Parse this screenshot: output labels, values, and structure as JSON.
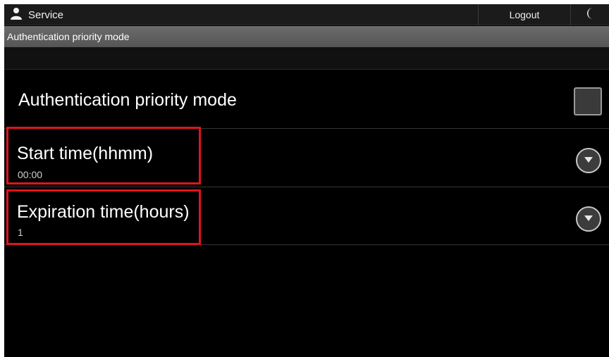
{
  "status_bar": {
    "user_label": "Service",
    "logout_label": "Logout"
  },
  "title_bar": {
    "title": "Authentication priority mode"
  },
  "settings": {
    "auth_mode": {
      "label": "Authentication priority mode",
      "checked": false
    },
    "start_time": {
      "label": "Start time(hhmm)",
      "value": "00:00"
    },
    "expiration_time": {
      "label": "Expiration time(hours)",
      "value": "1"
    }
  },
  "colors": {
    "background": "#000000",
    "title_bar": "#606060",
    "highlight": "#e0141b"
  },
  "icons": {
    "user": "user-icon",
    "moon": "moon-icon",
    "dropdown": "chevron-down-icon"
  }
}
